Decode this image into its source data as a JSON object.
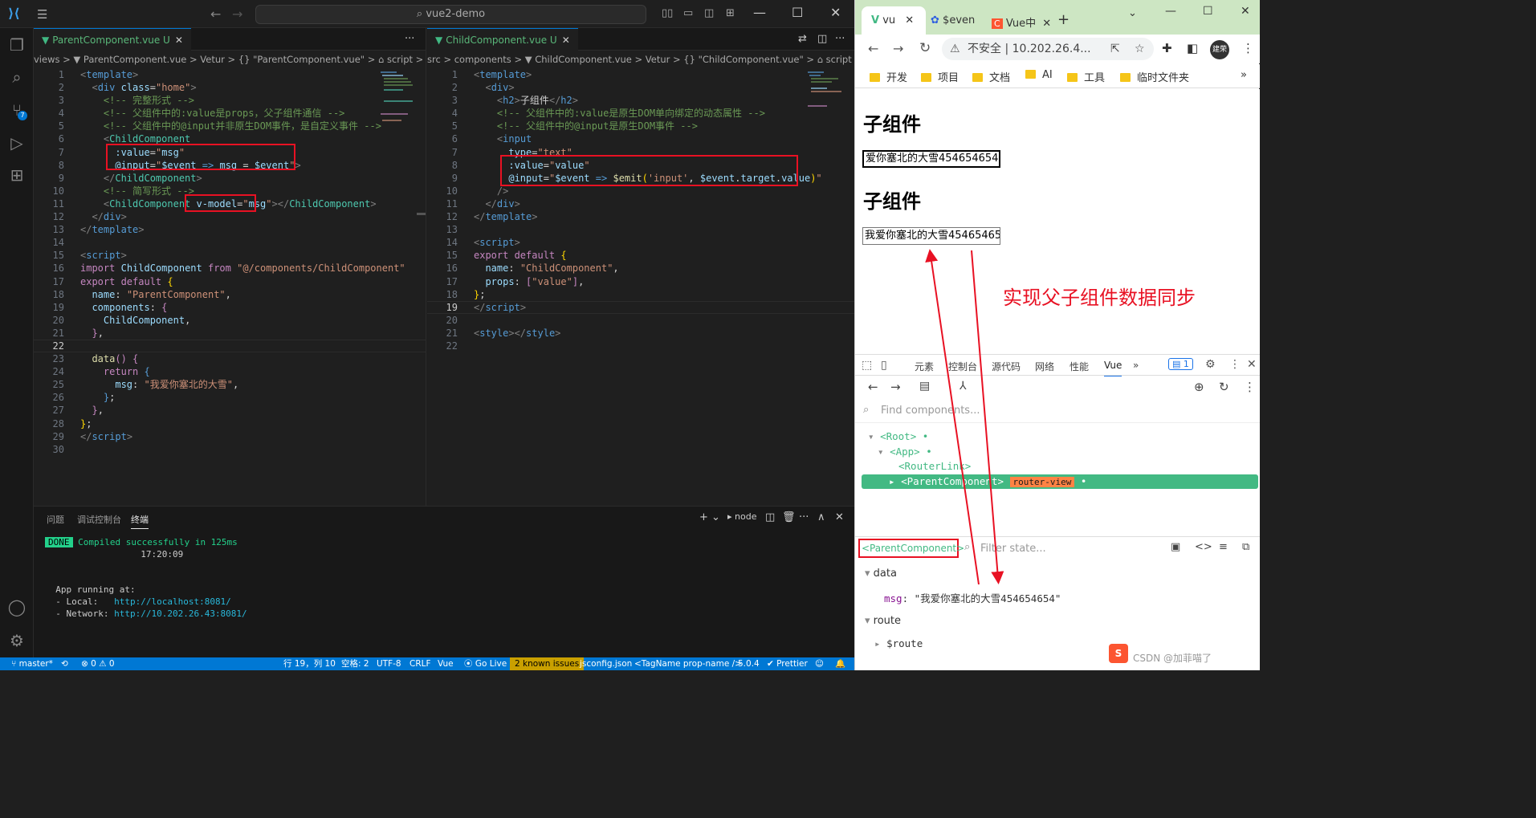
{
  "vscode": {
    "title": "vue2-demo",
    "activity_badge": "7",
    "left": {
      "tab": "ParentComponent.vue U",
      "crumbs": "views > ▼ ParentComponent.vue > Vetur > {} \"ParentComponent.vue\" > ⌂ script > ⌂ default",
      "lines": [
        {
          "n": "1",
          "h": "<span class='tg'>&lt;</span><span class='tn'>template</span><span class='tg'>&gt;</span>"
        },
        {
          "n": "2",
          "h": "  <span class='tg'>&lt;</span><span class='tn'>div</span> <span class='at'>class</span><span class='tx'>=</span><span class='st'>\"home\"</span><span class='tg'>&gt;</span>"
        },
        {
          "n": "3",
          "h": "    <span class='cm'>&lt;!-- 完整形式 --&gt;</span>"
        },
        {
          "n": "4",
          "h": "    <span class='cm'>&lt;!-- 父组件中的:value是props，父子组件通信 --&gt;</span>"
        },
        {
          "n": "5",
          "h": "    <span class='cm'>&lt;!-- 父组件中的@input并非原生DOM事件，是自定义事件 --&gt;</span>"
        },
        {
          "n": "6",
          "h": "    <span class='tg'>&lt;</span><span class='cl'>ChildComponent</span>"
        },
        {
          "n": "7",
          "h": "      <span class='at'>:value</span><span class='tx'>=</span><span class='st'>\"</span><span class='vb'>msg</span><span class='st'>\"</span>"
        },
        {
          "n": "8",
          "h": "      <span class='at'>@input</span><span class='tx'>=</span><span class='st'>\"</span><span class='vb'>$event</span> <span class='tn'>=&gt;</span> <span class='vb'>msg</span> <span class='tx'>=</span> <span class='vb'>$event</span><span class='st'>\"</span><span class='tg'>&gt;</span>"
        },
        {
          "n": "9",
          "h": "    <span class='tg'>&lt;/</span><span class='cl'>ChildComponent</span><span class='tg'>&gt;</span>"
        },
        {
          "n": "10",
          "h": "    <span class='cm'>&lt;!-- 简写形式 --&gt;</span>"
        },
        {
          "n": "11",
          "h": "    <span class='tg'>&lt;</span><span class='cl'>ChildComponent</span> <span class='at'>v-model</span><span class='tx'>=</span><span class='st'>\"</span><span class='vb'>msg</span><span class='st'>\"</span><span class='tg'>&gt;&lt;/</span><span class='cl'>ChildComponent</span><span class='tg'>&gt;</span>"
        },
        {
          "n": "12",
          "h": "  <span class='tg'>&lt;/</span><span class='tn'>div</span><span class='tg'>&gt;</span>"
        },
        {
          "n": "13",
          "h": "<span class='tg'>&lt;/</span><span class='tn'>template</span><span class='tg'>&gt;</span>"
        },
        {
          "n": "14",
          "h": ""
        },
        {
          "n": "15",
          "h": "<span class='tg'>&lt;</span><span class='tn'>script</span><span class='tg'>&gt;</span>"
        },
        {
          "n": "16",
          "h": "<span class='kw'>import</span> <span class='vb'>ChildComponent</span> <span class='kw'>from</span> <span class='st'>\"@/components/ChildComponent\"</span>"
        },
        {
          "n": "17",
          "h": "<span class='kw'>export default</span> <span class='pn'>{</span>"
        },
        {
          "n": "18",
          "h": "  <span class='vb'>name</span><span class='tx'>:</span> <span class='st'>\"ParentComponent\"</span><span class='tx'>,</span>"
        },
        {
          "n": "19",
          "h": "  <span class='vb'>components</span><span class='tx'>:</span> <span class='kw'>{</span>"
        },
        {
          "n": "20",
          "h": "    <span class='vb'>ChildComponent</span><span class='tx'>,</span>"
        },
        {
          "n": "21",
          "h": "  <span class='kw'>}</span><span class='tx'>,</span>"
        },
        {
          "n": "22",
          "h": ""
        },
        {
          "n": "23",
          "h": "  <span class='fn'>data</span><span class='kw'>()</span> <span class='kw'>{</span>"
        },
        {
          "n": "24",
          "h": "    <span class='kw'>return</span> <span class='tn'>{</span>"
        },
        {
          "n": "25",
          "h": "      <span class='vb'>msg</span><span class='tx'>:</span> <span class='st'>\"我爱你塞北的大雪\"</span><span class='tx'>,</span>"
        },
        {
          "n": "26",
          "h": "    <span class='tn'>}</span><span class='tx'>;</span>"
        },
        {
          "n": "27",
          "h": "  <span class='kw'>}</span><span class='tx'>,</span>"
        },
        {
          "n": "28",
          "h": "<span class='pn'>}</span><span class='tx'>;</span>"
        },
        {
          "n": "29",
          "h": "<span class='tg'>&lt;/</span><span class='tn'>script</span><span class='tg'>&gt;</span>"
        },
        {
          "n": "30",
          "h": ""
        }
      ]
    },
    "right": {
      "tab": "ChildComponent.vue U",
      "crumbs": "src > components > ▼ ChildComponent.vue > Vetur > {} \"ChildComponent.vue\" > ⌂ script",
      "lines": [
        {
          "n": "1",
          "h": "<span class='tg'>&lt;</span><span class='tn'>template</span><span class='tg'>&gt;</span>"
        },
        {
          "n": "2",
          "h": "  <span class='tg'>&lt;</span><span class='tn'>div</span><span class='tg'>&gt;</span>"
        },
        {
          "n": "3",
          "h": "    <span class='tg'>&lt;</span><span class='tn'>h2</span><span class='tg'>&gt;</span><span class='tx'>子组件</span><span class='tg'>&lt;/</span><span class='tn'>h2</span><span class='tg'>&gt;</span>"
        },
        {
          "n": "4",
          "h": "    <span class='cm'>&lt;!-- 父组件中的:value是原生DOM单向绑定的动态属性 --&gt;</span>"
        },
        {
          "n": "5",
          "h": "    <span class='cm'>&lt;!-- 父组件中的@input是原生DOM事件 --&gt;</span>"
        },
        {
          "n": "6",
          "h": "    <span class='tg'>&lt;</span><span class='tn'>input</span>"
        },
        {
          "n": "7",
          "h": "      <span class='at'>type</span><span class='tx'>=</span><span class='st'>\"text\"</span>"
        },
        {
          "n": "8",
          "h": "      <span class='at'>:value</span><span class='tx'>=</span><span class='st'>\"</span><span class='vb'>value</span><span class='st'>\"</span>"
        },
        {
          "n": "9",
          "h": "      <span class='at'>@input</span><span class='tx'>=</span><span class='st'>\"</span><span class='vb'>$event</span> <span class='tn'>=&gt;</span> <span class='fn'>$emit</span><span class='pn'>(</span><span class='st'>'input'</span><span class='tx'>,</span> <span class='vb'>$event</span><span class='tx'>.</span><span class='vb'>target</span><span class='tx'>.</span><span class='vb'>value</span><span class='pn'>)</span><span class='st'>\"</span>"
        },
        {
          "n": "10",
          "h": "    <span class='tg'>/&gt;</span>"
        },
        {
          "n": "11",
          "h": "  <span class='tg'>&lt;/</span><span class='tn'>div</span><span class='tg'>&gt;</span>"
        },
        {
          "n": "12",
          "h": "<span class='tg'>&lt;/</span><span class='tn'>template</span><span class='tg'>&gt;</span>"
        },
        {
          "n": "13",
          "h": ""
        },
        {
          "n": "14",
          "h": "<span class='tg'>&lt;</span><span class='tn'>script</span><span class='tg'>&gt;</span>"
        },
        {
          "n": "15",
          "h": "<span class='kw'>export default</span> <span class='pn'>{</span>"
        },
        {
          "n": "16",
          "h": "  <span class='vb'>name</span><span class='tx'>:</span> <span class='st'>\"ChildComponent\"</span><span class='tx'>,</span>"
        },
        {
          "n": "17",
          "h": "  <span class='vb'>props</span><span class='tx'>:</span> <span class='kw'>[</span><span class='st'>\"value\"</span><span class='kw'>]</span><span class='tx'>,</span>"
        },
        {
          "n": "18",
          "h": "<span class='pn'>}</span><span class='tx'>;</span>"
        },
        {
          "n": "19",
          "h": "<span class='tg'>&lt;/</span><span class='tn'>script</span><span class='tg'>&gt;</span>"
        },
        {
          "n": "20",
          "h": ""
        },
        {
          "n": "21",
          "h": "<span class='tg'>&lt;</span><span class='tn'>style</span><span class='tg'>&gt;&lt;/</span><span class='tn'>style</span><span class='tg'>&gt;</span>"
        },
        {
          "n": "22",
          "h": ""
        }
      ]
    },
    "panel": {
      "tabs": [
        "问题",
        "调试控制台",
        "终端"
      ],
      "shell": "node",
      "done": "DONE",
      "compiled": " Compiled successfully in 125ms",
      "time": "17:20:09",
      "running": "App running at:",
      "local_label": "- Local:   ",
      "local_url": "http://localhost:8081/",
      "network_label": "- Network: ",
      "network_url": "http://10.202.26.43:8081/"
    },
    "status": {
      "branch": "master*",
      "errors": "⊗ 0 ⚠ 0",
      "position": "行 19，列 10",
      "spaces": "空格: 2",
      "encoding": "UTF-8",
      "eol": "CRLF",
      "lang": "Vue",
      "golive": "Go Live",
      "issues": "2 known issues",
      "jsconfig": "jsconfig.json",
      "tagname": "<TagName prop-name />",
      "version": "5.0.4",
      "prettier": "✔ Prettier"
    }
  },
  "browser": {
    "tabs": [
      "vu",
      "$even",
      "Vue中"
    ],
    "insecure": "不安全",
    "url": "10.202.26.4...",
    "avatar": "建荣",
    "bookmarks": [
      "开发",
      "项目",
      "文档",
      "AI",
      "工具",
      "临时文件夹"
    ],
    "page": {
      "h2": "子组件",
      "input1": "爱你塞北的大雪454654654",
      "input2": "我爱你塞北的大雪45465465",
      "note": "实现父子组件数据同步"
    },
    "devtools": {
      "tabs": [
        "元素",
        "控制台",
        "源代码",
        "网络",
        "性能",
        "Vue"
      ],
      "msgcount": "1",
      "find_placeholder": "Find components...",
      "tree": {
        "root": "<Root>",
        "app": "<App>",
        "routerlink": "<RouterLink>",
        "parent": "<ParentComponent>",
        "routerview": "router-view"
      },
      "selected": "<ParentComponent>",
      "filter_placeholder": "Filter state...",
      "data_label": "data",
      "msg_key": "msg",
      "msg_value": "\"我爱你塞北的大雪454654654\"",
      "route_label": "route",
      "route_key": "$route",
      "watermark": "CSDN @加菲喵了"
    }
  },
  "colors": {
    "accent": "#0078d4",
    "annotation_red": "#e81123",
    "vue_green": "#42b983"
  }
}
